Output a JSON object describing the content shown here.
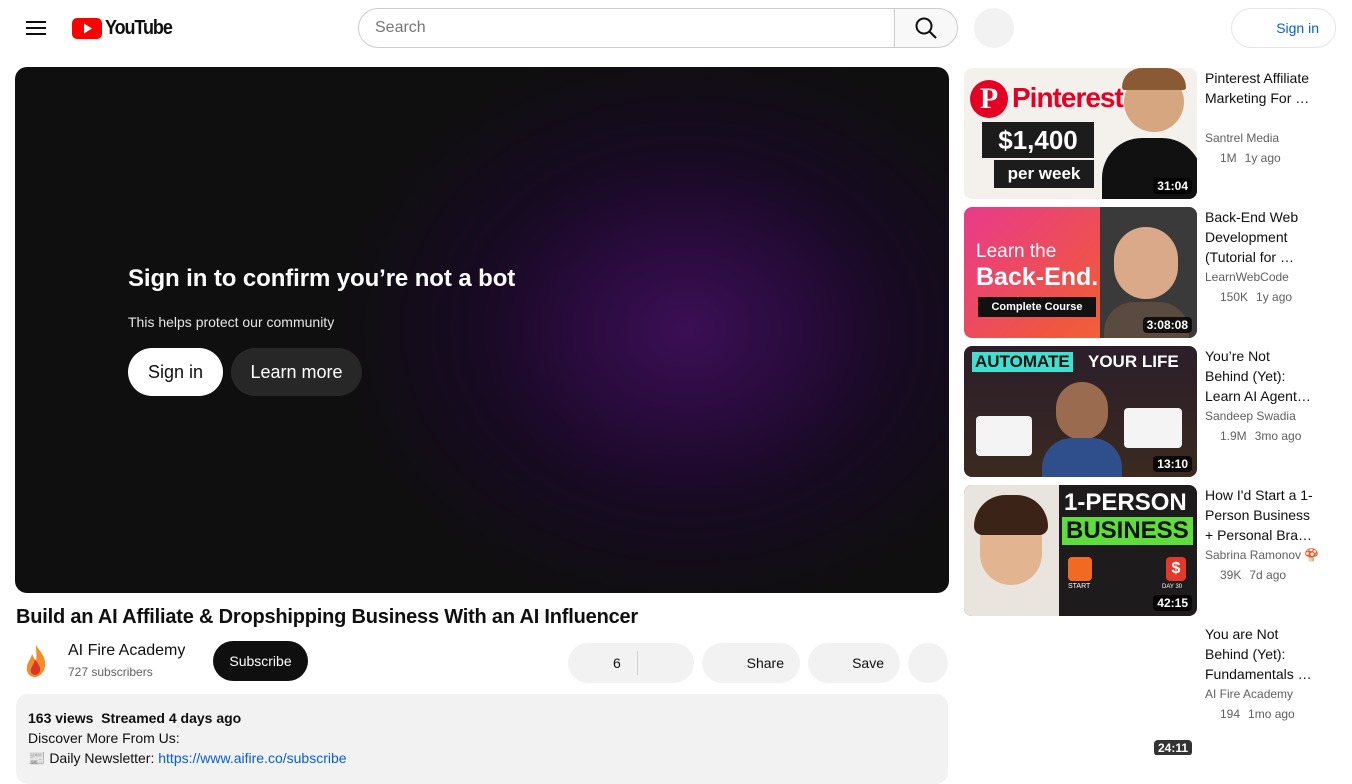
{
  "header": {
    "logo_text": "YouTube",
    "search_placeholder": "Search",
    "sign_in": "Sign in"
  },
  "player": {
    "overlay_title": "Sign in to confirm you’re not a bot",
    "overlay_subtitle": "This helps protect our community",
    "sign_in_button": "Sign in",
    "learn_more_button": "Learn more"
  },
  "video": {
    "title": "Build an AI Affiliate & Dropshipping Business With an AI Influencer",
    "channel_name": "AI Fire Academy",
    "subscribers": "727 subscribers",
    "subscribe_label": "Subscribe",
    "like_count": "6",
    "share_label": "Share",
    "save_label": "Save"
  },
  "description": {
    "views": "163 views",
    "date": "Streamed 4 days ago",
    "line1": "Discover More From Us:",
    "line2_prefix": "📰 Daily Newsletter: ",
    "line2_link": "https://www.aifire.co/subscribe"
  },
  "recommendations": [
    {
      "title": "Pinterest Affiliate Marketing For …",
      "channel": "Santrel Media",
      "views": "1M",
      "age": "1y ago",
      "duration": "31:04",
      "thumb_text": [
        "Pinterest",
        "$1,400",
        "per week"
      ]
    },
    {
      "title": "Back-End Web Development (Tutorial for …",
      "channel": "LearnWebCode",
      "views": "150K",
      "age": "1y ago",
      "duration": "3:08:08",
      "thumb_text": [
        "Learn the",
        "Back-End.",
        "Complete Course"
      ]
    },
    {
      "title": "You’re Not Behind (Yet): Learn AI Agent…",
      "channel": "Sandeep Swadia",
      "views": "1.9M",
      "age": "3mo ago",
      "duration": "13:10",
      "thumb_text": [
        "AUTOMATE",
        "YOUR LIFE"
      ]
    },
    {
      "title": "How I'd Start a 1-Person Business + Personal Bra…",
      "channel": "Sabrina Ramonov 🍄",
      "views": "39K",
      "age": "7d ago",
      "duration": "42:15",
      "thumb_text": [
        "1-PERSON",
        "BUSINESS",
        "START",
        "DAY 30"
      ]
    },
    {
      "title": "You are Not Behind (Yet): Fundamentals …",
      "channel": "AI Fire Academy",
      "views": "194",
      "age": "1mo ago",
      "duration": "24:11"
    }
  ],
  "colors": {
    "brand_red": "#ff0000",
    "link_blue": "#065fd4"
  }
}
